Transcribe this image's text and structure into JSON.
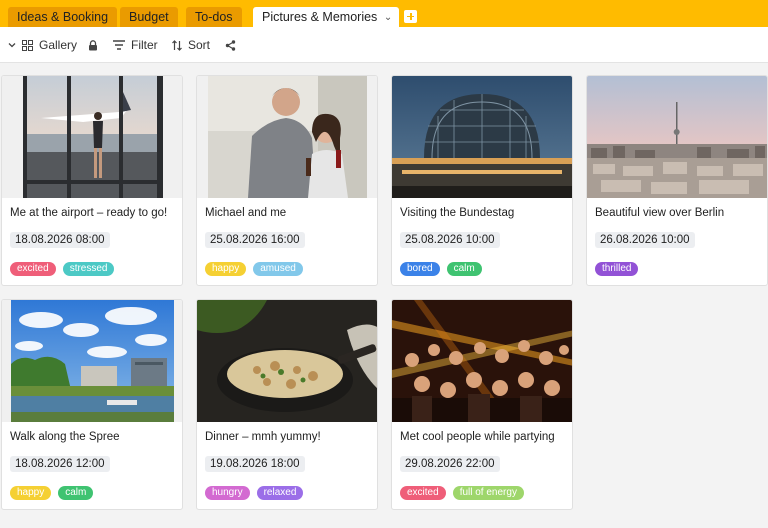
{
  "tabs": [
    {
      "label": "Ideas & Booking"
    },
    {
      "label": "Budget"
    },
    {
      "label": "To-dos"
    },
    {
      "label": "Pictures & Memories"
    }
  ],
  "toolbar": {
    "view_label": "Gallery",
    "filter_label": "Filter",
    "sort_label": "Sort"
  },
  "colors": {
    "accent": "#ffbb00",
    "tab_inactive": "#ea9b00"
  },
  "cards": [
    {
      "title": "Me at the airport – ready to go!",
      "date": "18.08.2026 08:00",
      "tags": [
        {
          "label": "excited",
          "color": "#ef5e79"
        },
        {
          "label": "stressed",
          "color": "#4cc9c5"
        }
      ]
    },
    {
      "title": "Michael and me",
      "date": "25.08.2026 16:00",
      "tags": [
        {
          "label": "happy",
          "color": "#f5d033"
        },
        {
          "label": "amused",
          "color": "#82c8ea"
        }
      ]
    },
    {
      "title": "Visiting the Bundestag",
      "date": "25.08.2026 10:00",
      "tags": [
        {
          "label": "bored",
          "color": "#3b82e8"
        },
        {
          "label": "calm",
          "color": "#3fc371"
        }
      ]
    },
    {
      "title": "Beautiful view over Berlin",
      "date": "26.08.2026 10:00",
      "tags": [
        {
          "label": "thrilled",
          "color": "#9252d6"
        }
      ]
    },
    {
      "title": "Walk along the Spree",
      "date": "18.08.2026 12:00",
      "tags": [
        {
          "label": "happy",
          "color": "#f5d033"
        },
        {
          "label": "calm",
          "color": "#3fc371"
        }
      ]
    },
    {
      "title": "Dinner – mmh yummy!",
      "date": "19.08.2026 18:00",
      "tags": [
        {
          "label": "hungry",
          "color": "#d36ad1"
        },
        {
          "label": "relaxed",
          "color": "#9b6ee8"
        }
      ]
    },
    {
      "title": "Met cool people while partying",
      "date": "29.08.2026 22:00",
      "tags": [
        {
          "label": "excited",
          "color": "#ef5e79"
        },
        {
          "label": "full of energy",
          "color": "#9ed66b"
        }
      ]
    }
  ]
}
